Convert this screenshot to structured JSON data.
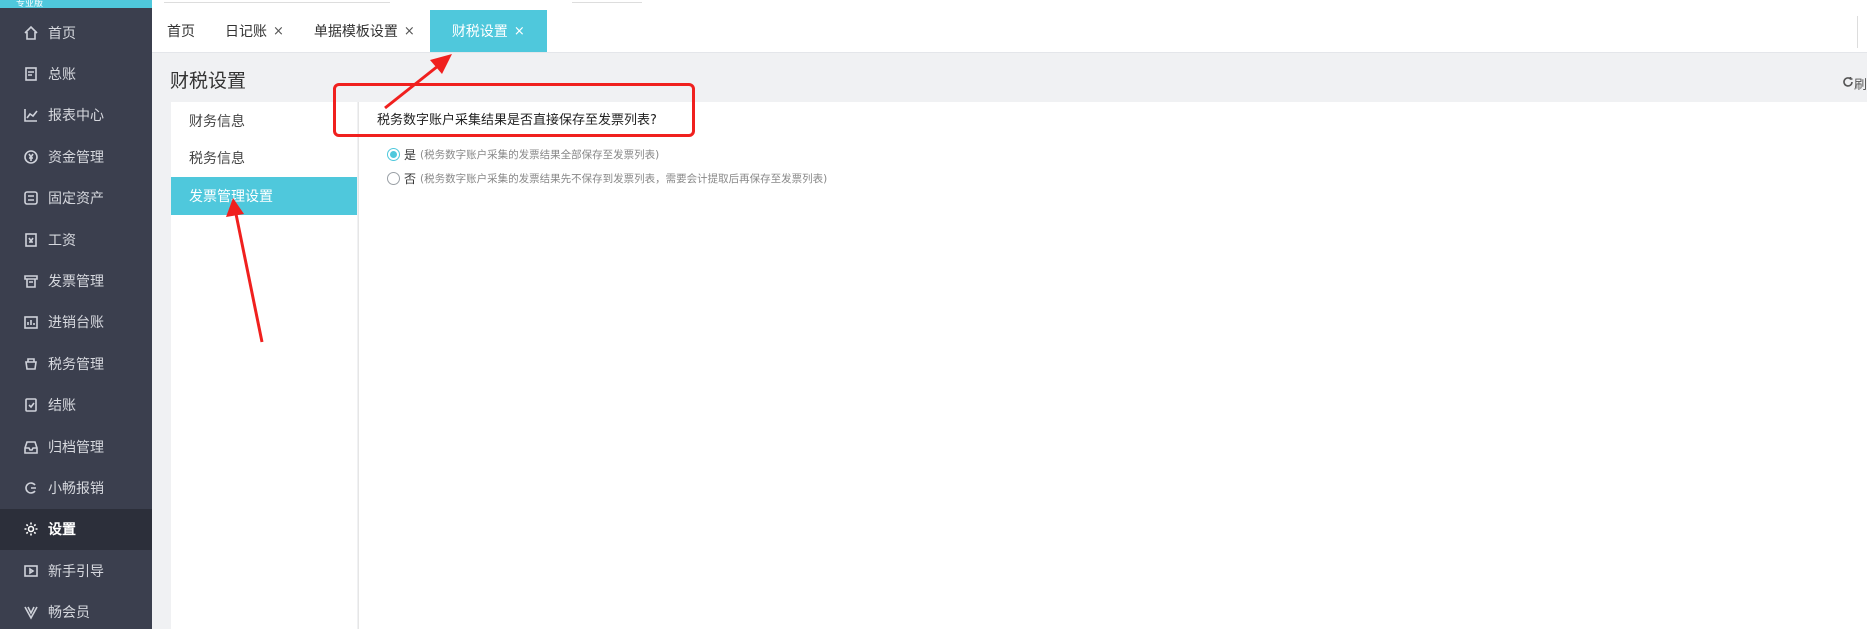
{
  "brand": {
    "text": "专业版"
  },
  "sidebar": {
    "items": [
      {
        "label": "首页",
        "icon": "home-icon"
      },
      {
        "label": "总账",
        "icon": "ledger-icon"
      },
      {
        "label": "报表中心",
        "icon": "chart-icon"
      },
      {
        "label": "资金管理",
        "icon": "money-icon"
      },
      {
        "label": "固定资产",
        "icon": "asset-icon"
      },
      {
        "label": "工资",
        "icon": "salary-icon"
      },
      {
        "label": "发票管理",
        "icon": "invoice-icon"
      },
      {
        "label": "进销台账",
        "icon": "inventory-icon"
      },
      {
        "label": "税务管理",
        "icon": "tax-icon"
      },
      {
        "label": "结账",
        "icon": "closing-icon"
      },
      {
        "label": "归档管理",
        "icon": "archive-icon"
      },
      {
        "label": "小畅报销",
        "icon": "reimburse-icon"
      },
      {
        "label": "设置",
        "icon": "gear-icon",
        "active": true
      },
      {
        "label": "新手引导",
        "icon": "guide-icon"
      },
      {
        "label": "畅会员",
        "icon": "vip-icon"
      }
    ]
  },
  "tabs": [
    {
      "label": "首页",
      "closable": false
    },
    {
      "label": "日记账",
      "closable": true
    },
    {
      "label": "单据模板设置",
      "closable": true
    },
    {
      "label": "财税设置",
      "closable": true,
      "active": true
    }
  ],
  "close_glyph": "×",
  "page": {
    "title": "财税设置",
    "refresh_label": "刷"
  },
  "settings_menu": [
    {
      "label": "财务信息"
    },
    {
      "label": "税务信息"
    },
    {
      "label": "发票管理设置",
      "active": true
    }
  ],
  "content": {
    "question": "税务数字账户采集结果是否直接保存至发票列表?",
    "options": [
      {
        "label": "是",
        "hint": "(税务数字账户采集的发票结果全部保存至发票列表)",
        "checked": true
      },
      {
        "label": "否",
        "hint": "(税务数字账户采集的发票结果先不保存到发票列表，需要会计提取后再保存至发票列表)",
        "checked": false
      }
    ]
  },
  "colors": {
    "accent": "#4fc8dc",
    "sidebar_bg": "#3b3f4e",
    "annotation_red": "#f0201e"
  }
}
